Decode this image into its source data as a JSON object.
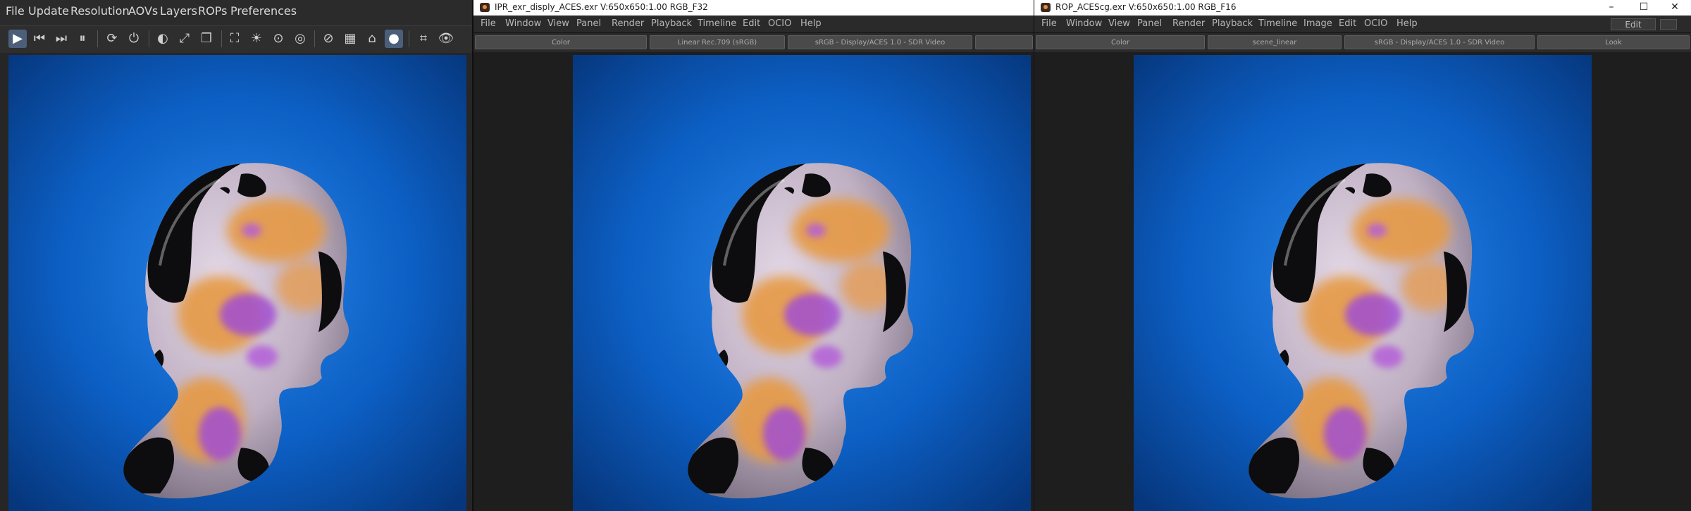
{
  "ipr": {
    "menu": [
      "File",
      "Update",
      "Resolution",
      "AOVs",
      "Layers",
      "ROPs",
      "Preferences"
    ],
    "toolbar_icons": [
      "render-play-icon",
      "step-back-icon",
      "step-forward-icon",
      "pause-icon",
      "refresh-icon",
      "power-icon",
      "contrast-icon",
      "fit-frame-icon",
      "snapshot-icon",
      "region-select-icon",
      "exposure-icon",
      "menu-dots-icon",
      "target-icon",
      "reset-icon",
      "grid-icon",
      "home-icon",
      "display-mode-icon",
      "crop-icon",
      "eye-icon"
    ]
  },
  "mid": {
    "title": "IPR_exr_disply_ACES.exr V:650x650:1.00 RGB_F32",
    "menu": [
      "File",
      "Window",
      "View",
      "Panel",
      "Render",
      "Playback",
      "Timeline",
      "Edit",
      "OCIO",
      "Help"
    ],
    "ocio": [
      "Color",
      "Linear Rec.709 (sRGB)",
      "sRGB - Display/ACES 1.0 - SDR Video"
    ]
  },
  "right": {
    "title": "ROP_ACEScg.exr V:650x650:1.00 RGB_F16",
    "menu": [
      "File",
      "Window",
      "View",
      "Panel",
      "Render",
      "Playback",
      "Timeline",
      "Image",
      "Edit",
      "OCIO",
      "Help"
    ],
    "edit_label": "Edit",
    "ocio": [
      "Color",
      "scene_linear",
      "sRGB - Display/ACES 1.0 - SDR Video",
      "Look"
    ],
    "window_controls": {
      "minimize": "–",
      "maximize": "☐",
      "close": "✕"
    }
  },
  "colors": {
    "background_blue": "#0c5fc4",
    "skin_base": "#c7b9c8",
    "orange_patch": "#e69a45",
    "purple_patch": "#a14fd2",
    "black_patch": "#0d0d0f"
  }
}
